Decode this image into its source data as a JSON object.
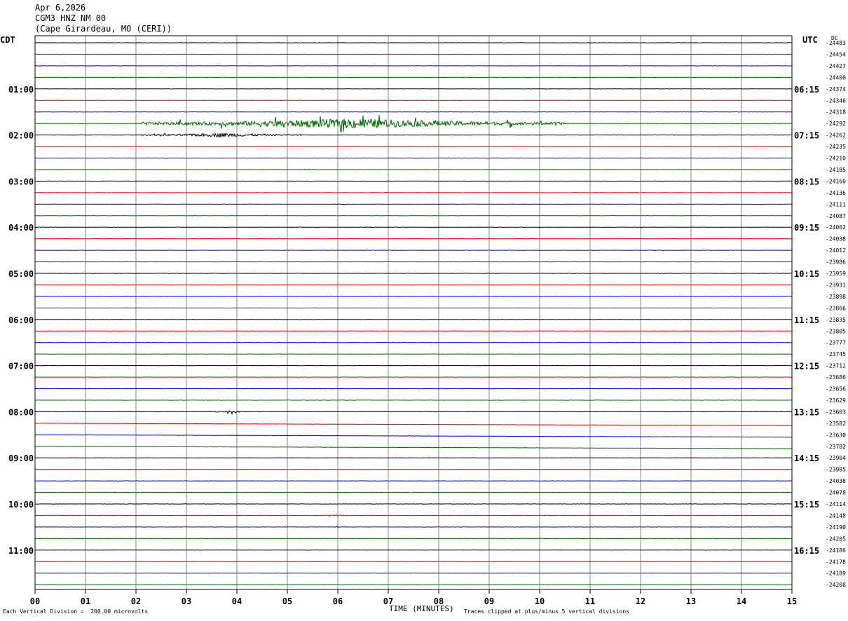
{
  "header": {
    "date": "Apr 6,2026",
    "channel": "CGM3 HNZ NM 00",
    "location": "(Cape Girardeau, MO (CERI))"
  },
  "left_axis_title": "CDT",
  "right_axis_title": "UTC",
  "dc_title": "DC",
  "footer": {
    "vertical_division": "Each Vertical Division =  200.00 microvolts",
    "clipping": "Traces clipped at plus/minus 5 vertical divisions"
  },
  "colors": {
    "trace_cycle": [
      "#000000",
      "#dd0000",
      "#0000cc",
      "#006600"
    ],
    "grid": "#888888",
    "frame": "#000000"
  },
  "chart_data": {
    "type": "line",
    "subtype": "helicorder",
    "xlabel": "TIME (MINUTES)",
    "xlim": [
      0,
      15
    ],
    "x_ticks": [
      "00",
      "01",
      "02",
      "03",
      "04",
      "05",
      "06",
      "07",
      "08",
      "09",
      "10",
      "11",
      "12",
      "13",
      "14",
      "15"
    ],
    "minutes_per_line": 15,
    "line_count": 48,
    "left_hour_labels": [
      "01:00",
      "02:00",
      "03:00",
      "04:00",
      "05:00",
      "06:00",
      "07:00",
      "08:00",
      "09:00",
      "10:00",
      "11:00"
    ],
    "right_hour_labels": [
      "06:15",
      "07:15",
      "08:15",
      "09:15",
      "10:15",
      "11:15",
      "12:15",
      "13:15",
      "14:15",
      "15:15",
      "16:15"
    ],
    "hour_label_first_line": 4,
    "dc_offsets": [
      -24483,
      -24454,
      -24427,
      -24400,
      -24374,
      -24346,
      -24318,
      -24292,
      -24262,
      -24235,
      -24210,
      -24185,
      -24160,
      -24136,
      -24111,
      -24087,
      -24062,
      -24038,
      -24012,
      -23986,
      -23959,
      -23931,
      -23898,
      -23866,
      -23835,
      -23805,
      -23777,
      -23745,
      -23712,
      -23686,
      -23656,
      -23629,
      -23603,
      -23582,
      -23630,
      -23782,
      -23904,
      -23985,
      -24038,
      -24078,
      -24114,
      -24148,
      -24190,
      -24205,
      -24186,
      -24178,
      -24189,
      -24208
    ],
    "events": [
      {
        "line": 7,
        "start_min": 2.1,
        "end_min": 10.5,
        "peak_amplitude": 5,
        "note": "large green trace, multiple clipped spikes"
      },
      {
        "line": 8,
        "start_min": 2.1,
        "end_min": 5.3,
        "peak_amplitude": 2
      },
      {
        "line": 11,
        "start_min": 5.2,
        "end_min": 5.6,
        "peak_amplitude": 0.6
      },
      {
        "line": 16,
        "start_min": 6.4,
        "end_min": 6.8,
        "peak_amplitude": 0.6
      },
      {
        "line": 32,
        "start_min": 3.45,
        "end_min": 4.25,
        "peak_amplitude": 1.0
      },
      {
        "line": 39,
        "start_min": 1.7,
        "end_min": 2.3,
        "peak_amplitude": 0.5
      },
      {
        "line": 41,
        "start_min": 5.5,
        "end_min": 6.5,
        "peak_amplitude": 0.5
      },
      {
        "line": 42,
        "start_min": 5.7,
        "end_min": 6.3,
        "peak_amplitude": 0.4
      }
    ],
    "drift_lines": [
      33,
      34,
      35
    ]
  }
}
